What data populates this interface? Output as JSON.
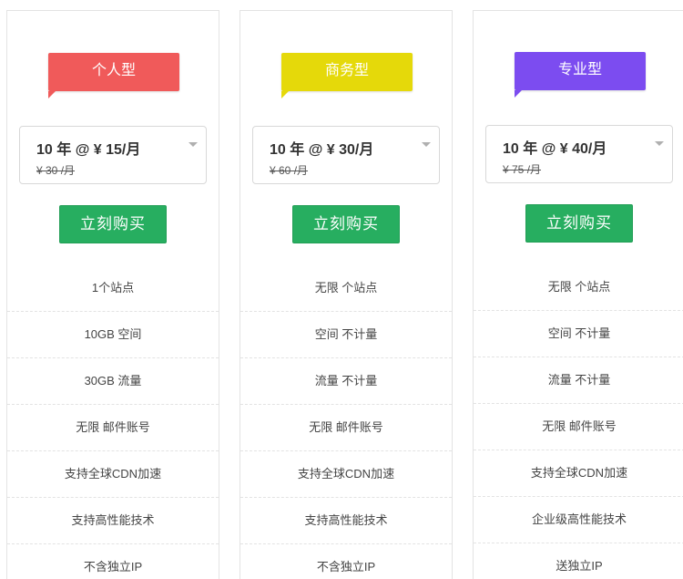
{
  "plans": [
    {
      "name": "个人型",
      "color": "#f05a5a",
      "price_option": "10 年 @ ¥ 15/月",
      "original_price": "¥ 30 /月",
      "buy_label": "立刻购买",
      "features": [
        "1个站点",
        "10GB 空间",
        "30GB 流量",
        "无限 邮件账号",
        "支持全球CDN加速",
        "支持高性能技术",
        "不含独立IP"
      ]
    },
    {
      "name": "商务型",
      "color": "#e5d90a",
      "price_option": "10 年 @ ¥ 30/月",
      "original_price": "¥ 60 /月",
      "buy_label": "立刻购买",
      "features": [
        "无限 个站点",
        "空间 不计量",
        "流量 不计量",
        "无限 邮件账号",
        "支持全球CDN加速",
        "支持高性能技术",
        "不含独立IP"
      ]
    },
    {
      "name": "专业型",
      "color": "#7c4cf0",
      "price_option": "10 年 @ ¥ 40/月",
      "original_price": "¥ 75 /月",
      "buy_label": "立刻购买",
      "features": [
        "无限 个站点",
        "空间 不计量",
        "流量 不计量",
        "无限 邮件账号",
        "支持全球CDN加速",
        "企业级高性能技术",
        "送独立IP"
      ]
    }
  ],
  "accent_button_color": "#27ae60"
}
